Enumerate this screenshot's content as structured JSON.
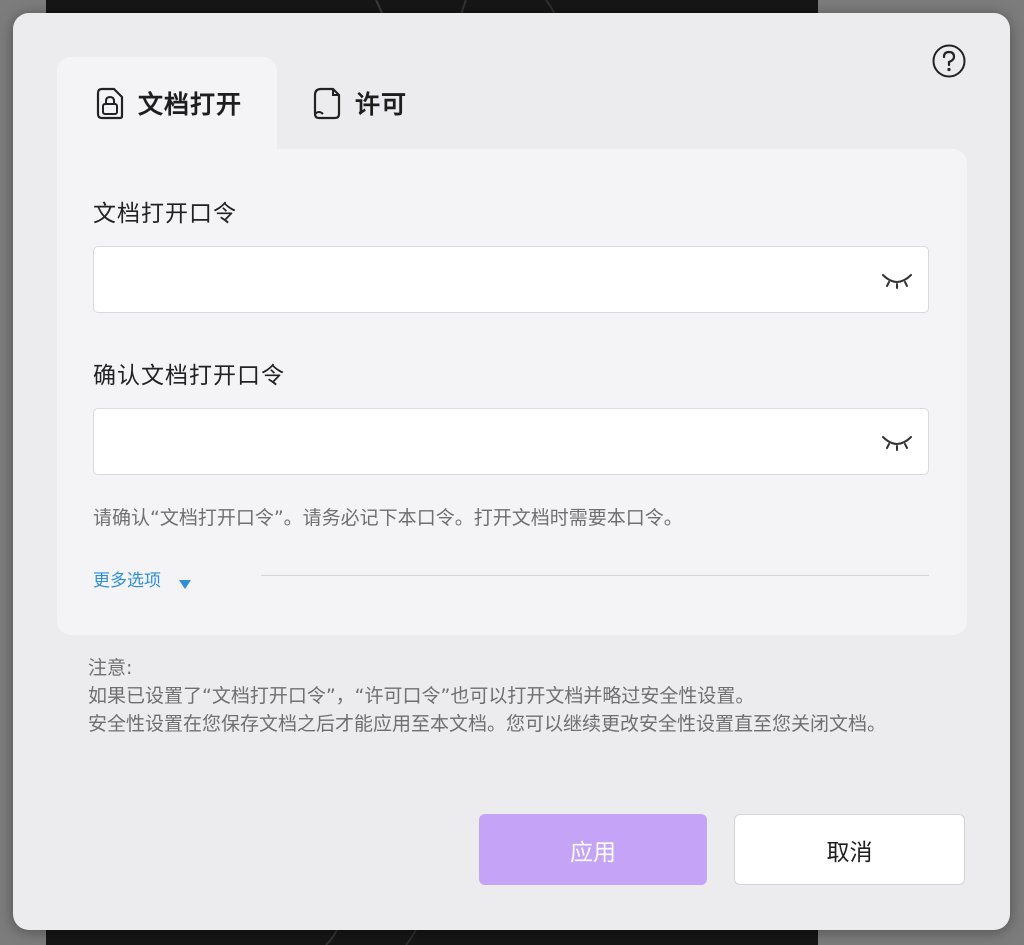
{
  "dialog": {
    "tabs": [
      {
        "label": "文档打开",
        "icon": "lock-document-icon",
        "active": true
      },
      {
        "label": "许可",
        "icon": "document-icon",
        "active": false
      }
    ],
    "help_icon": "help-icon"
  },
  "open_password": {
    "label": "文档打开口令",
    "value": "",
    "toggle_icon": "eye-closed-icon"
  },
  "confirm_password": {
    "label": "确认文档打开口令",
    "value": "",
    "toggle_icon": "eye-closed-icon"
  },
  "hint": "请确认“文档打开口令”。请务必记下本口令。打开文档时需要本口令。",
  "more_options": {
    "label": "更多选项",
    "icon": "caret-down-icon"
  },
  "note": {
    "title": "注意:",
    "line1": "如果已设置了“文档打开口令”，“许可口令”也可以打开文档并略过安全性设置。",
    "line2": "安全性设置在您保存文档之后才能应用至本文档。您可以继续更改安全性设置直至您关闭文档。"
  },
  "buttons": {
    "apply": "应用",
    "cancel": "取消"
  },
  "colors": {
    "accent": "#c5a3f6",
    "link": "#2f8fd9",
    "dialog_bg": "#ececee",
    "panel_bg": "#f4f4f6"
  }
}
